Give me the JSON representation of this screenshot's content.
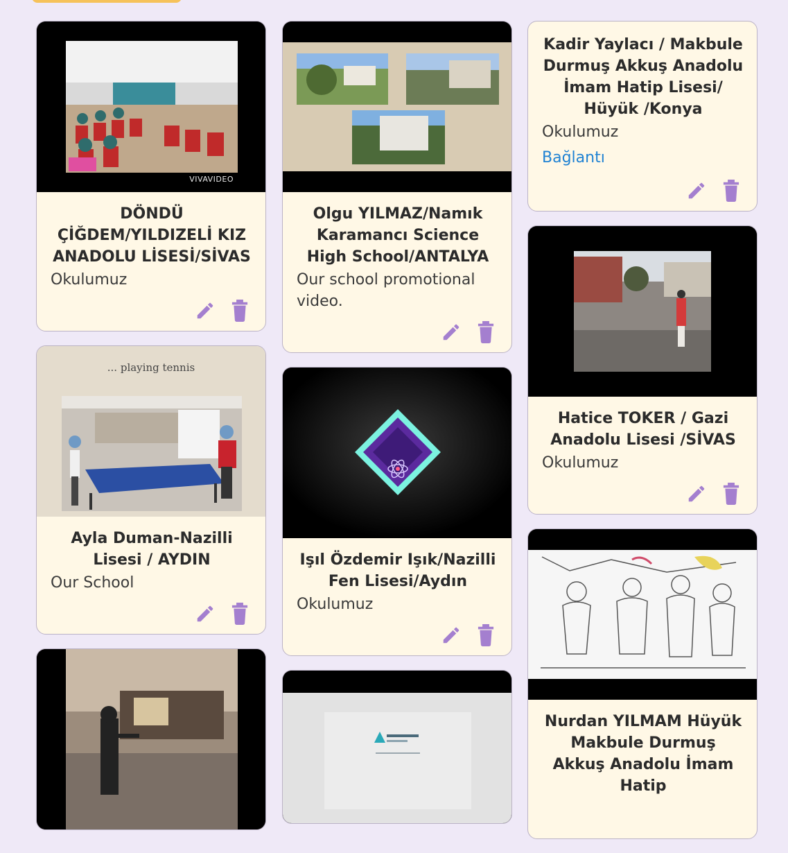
{
  "cards": {
    "c1": {
      "title": "DÖNDÜ ÇİĞDEM/YILDIZELİ KIZ ANADOLU LİSESİ/SİVAS",
      "description": "Okulumuz",
      "watermark": "VIVAVIDEO"
    },
    "c2": {
      "title": "Olgu YILMAZ/Namık Karamancı Science High School/ANTALYA",
      "description": "Our school promotional video."
    },
    "c3": {
      "title": "Kadir Yaylacı / Makbule Durmuş Akkuş Anadolu İmam Hatip Lisesi/ Hüyük /Konya",
      "description": "Okulumuz",
      "link": "Bağlantı"
    },
    "c4": {
      "title": "Ayla Duman-Nazilli Lisesi / AYDIN",
      "description": "Our School",
      "caption": "... playing tennis"
    },
    "c5": {
      "title": "Işıl Özdemir Işık/Nazilli Fen Lisesi/Aydın",
      "description": "Okulumuz"
    },
    "c6": {
      "title": "Hatice TOKER / Gazi Anadolu Lisesi /SİVAS",
      "description": "Okulumuz"
    },
    "c9": {
      "title": "Nurdan YILMAM Hüyük Makbule Durmuş Akkuş Anadolu İmam Hatip"
    }
  },
  "icons": {
    "edit": "pencil-icon",
    "delete": "trash-icon"
  },
  "colors": {
    "background": "#efe9f7",
    "card": "#fff8e6",
    "icon": "#a47fcf",
    "link": "#1f82d3",
    "accent_tab": "#f6c25a"
  }
}
